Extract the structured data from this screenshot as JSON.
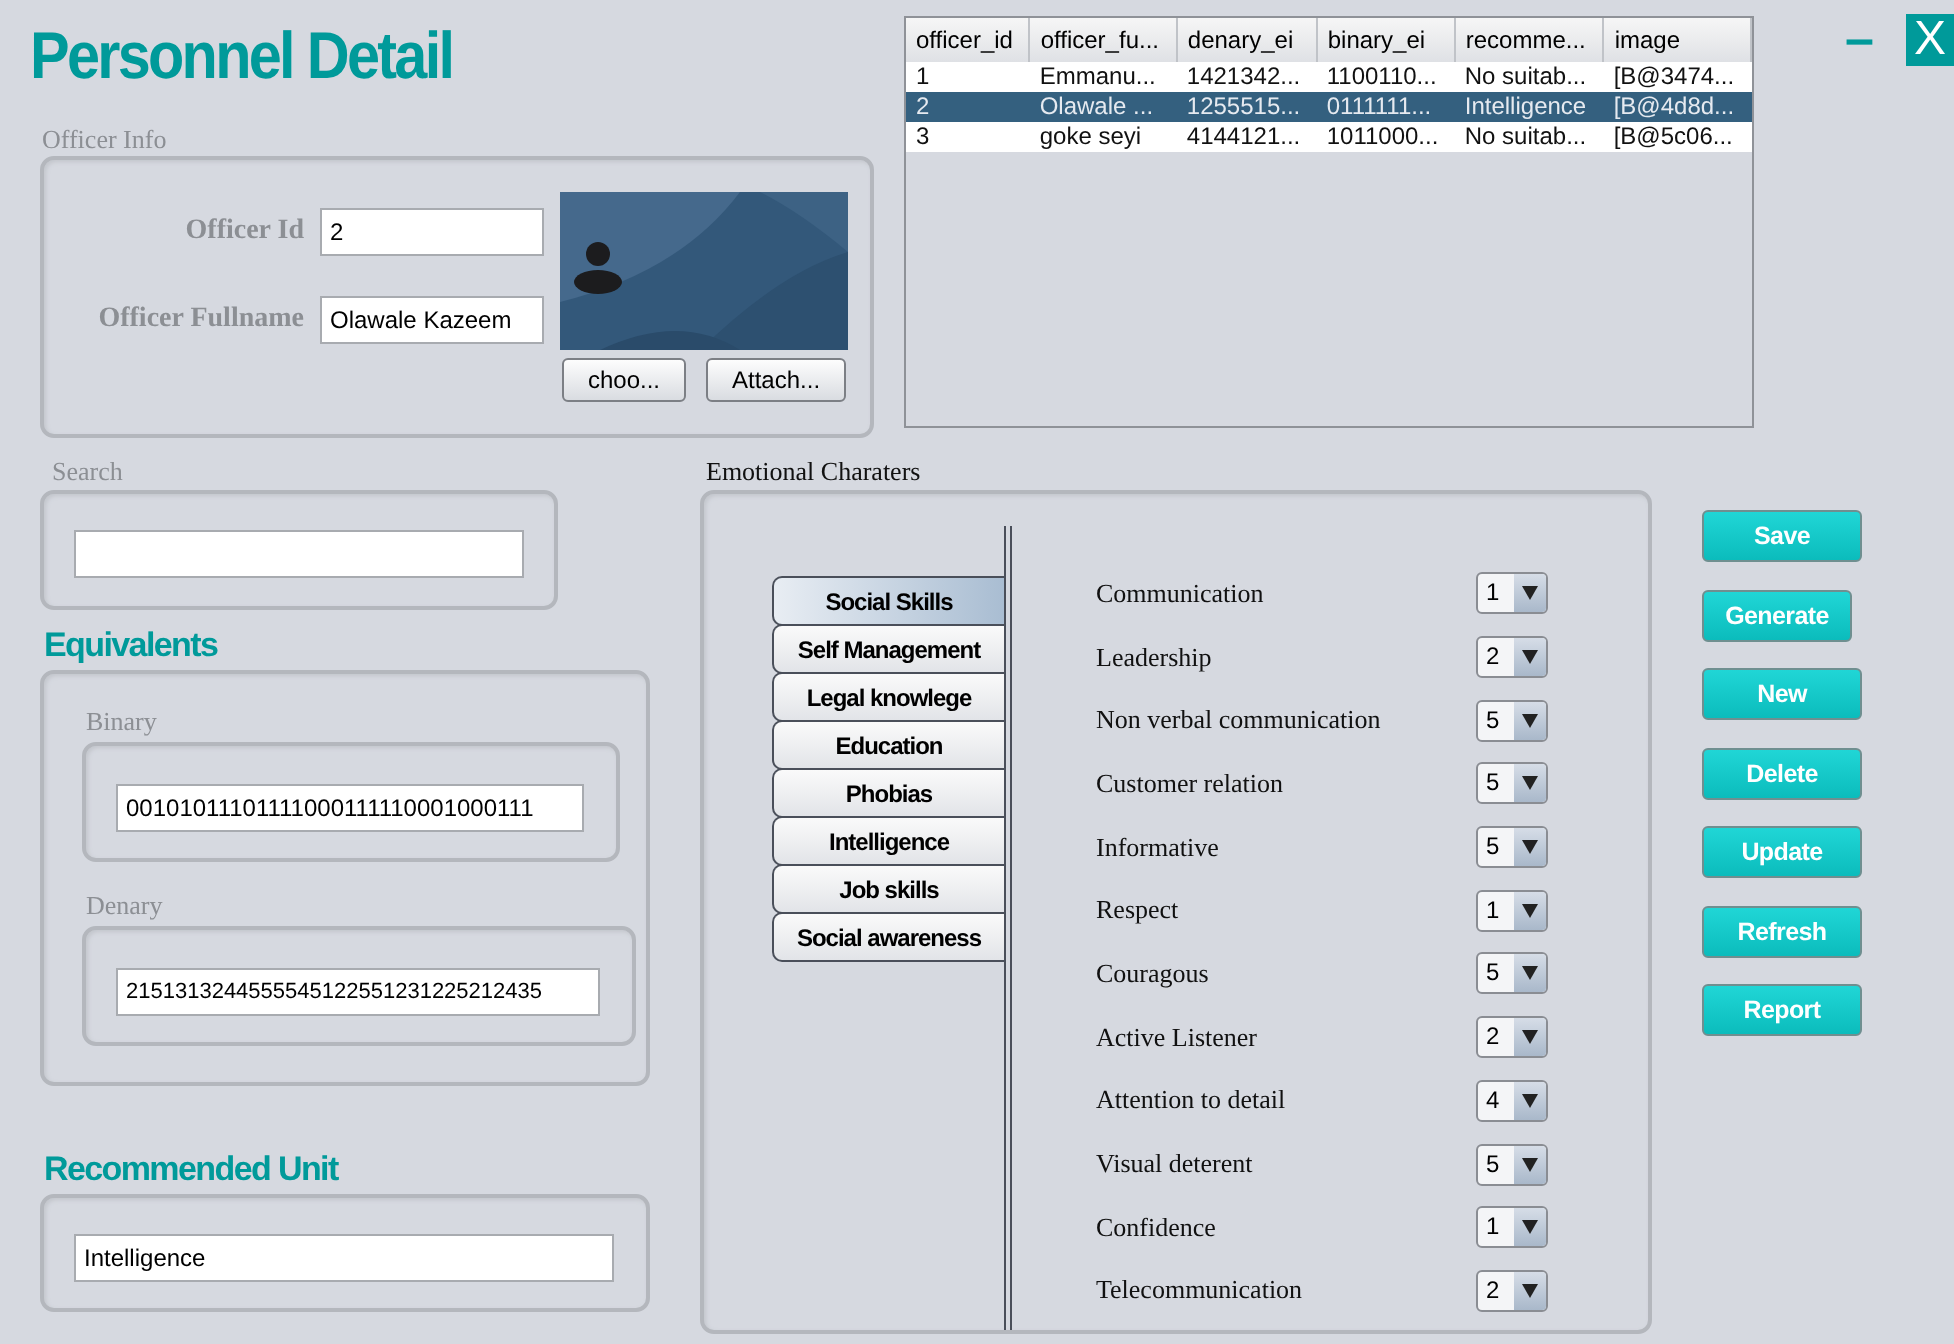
{
  "title": "Personnel Detail",
  "window_controls": [
    "–",
    "X"
  ],
  "officer_info": {
    "legend": "Officer Info",
    "id_label": "Officer Id",
    "id_value": "2",
    "fullname_label": "Officer Fullname",
    "fullname_value": "Olawale Kazeem",
    "photo": {
      "kind": "picture"
    },
    "buttons": [
      "choo...",
      "Attach..."
    ]
  },
  "table": {
    "columns": [
      "officer_id",
      "officer_fu...",
      "denary_ei",
      "binary_ei",
      "recomme...",
      "image"
    ],
    "rows": [
      {
        "selected": false,
        "cells": [
          "1",
          "Emmanu...",
          "1421342...",
          "1100110...",
          "No suitab...",
          "[B@3474..."
        ]
      },
      {
        "selected": true,
        "cells": [
          "2",
          "Olawale ...",
          "1255515...",
          "0111111...",
          "Intelligence",
          "[B@4d8d..."
        ]
      },
      {
        "selected": false,
        "cells": [
          "3",
          "goke seyi",
          "4144121...",
          "1011000...",
          "No suitab...",
          "[B@5c06..."
        ]
      }
    ]
  },
  "search": {
    "legend": "Search"
  },
  "equivalents": {
    "heading": "Equivalents",
    "binary_label": "Binary",
    "binary_value": "00101011101111000111110001000111",
    "denary_label": "Denary",
    "denary_value": "2151313244555545122551231225212435"
  },
  "recommended": {
    "heading": "Recommended Unit",
    "value": "Intelligence"
  },
  "emotional": {
    "legend": "Emotional Charaters",
    "tabs": [
      {
        "label": "Social Skills",
        "selected": true
      },
      {
        "label": "Self Management",
        "selected": false
      },
      {
        "label": "Legal knowlege",
        "selected": false
      },
      {
        "label": "Education",
        "selected": false
      },
      {
        "label": "Phobias",
        "selected": false
      },
      {
        "label": "Intelligence",
        "selected": false
      },
      {
        "label": "Job skills",
        "selected": false
      },
      {
        "label": "Social awareness",
        "selected": false
      }
    ],
    "traits": [
      {
        "label": "Communication",
        "value": "1"
      },
      {
        "label": "Leadership",
        "value": "2"
      },
      {
        "label": "Non verbal communication",
        "value": "5"
      },
      {
        "label": "Customer relation",
        "value": "5"
      },
      {
        "label": "Informative",
        "value": "5"
      },
      {
        "label": "Respect",
        "value": "1"
      },
      {
        "label": "Couragous",
        "value": "5"
      },
      {
        "label": "Active Listener",
        "value": "2"
      },
      {
        "label": "Attention to detail",
        "value": "4"
      },
      {
        "label": "Visual deterent",
        "value": "5"
      },
      {
        "label": "Confidence",
        "value": "1"
      },
      {
        "label": "Telecommunication",
        "value": "2"
      }
    ]
  },
  "actions": [
    "Save",
    "Generate",
    "New",
    "Delete",
    "Update",
    "Refresh",
    "Report"
  ]
}
